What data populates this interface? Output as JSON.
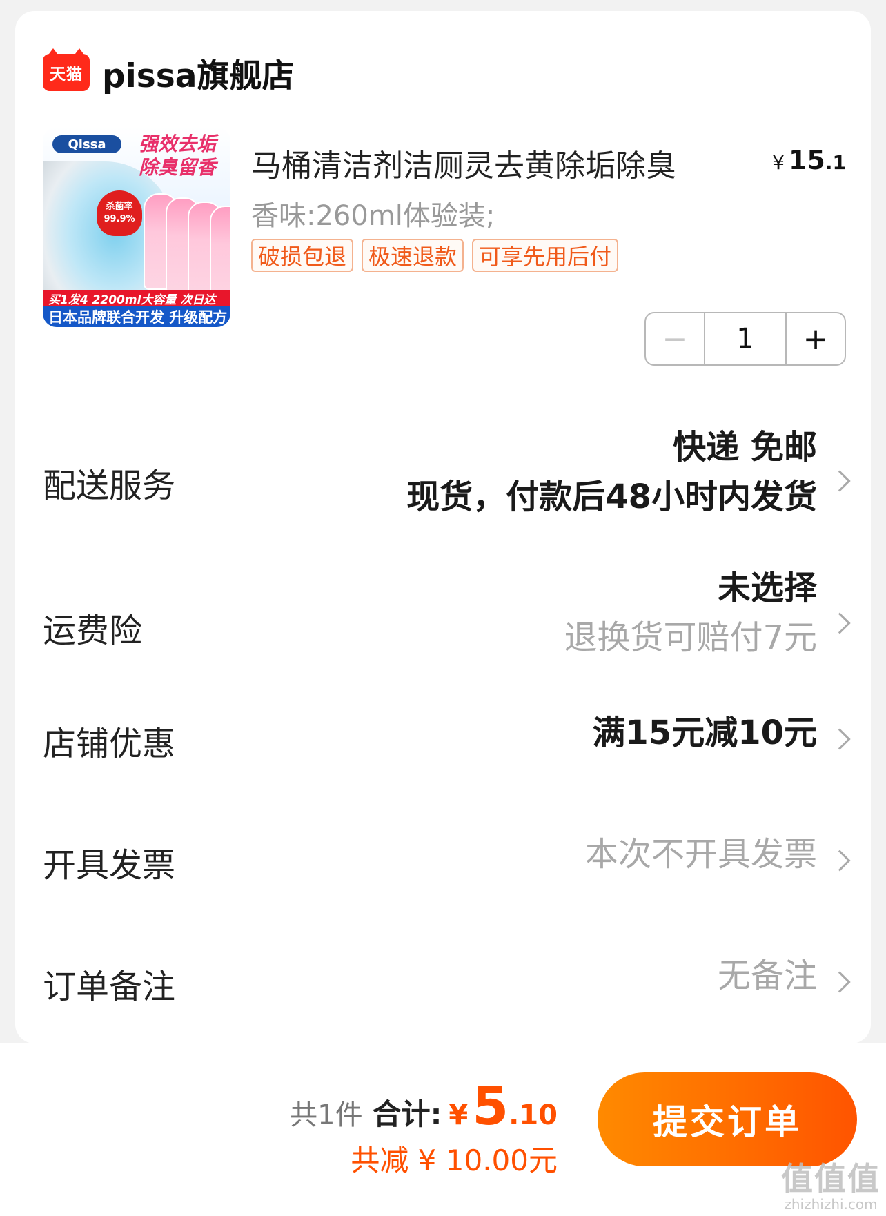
{
  "store": {
    "logo_text": "天猫",
    "name": "pissa旗舰店"
  },
  "product": {
    "title": "马桶清洁剂洁厕灵去黄除垢除臭",
    "price_symbol": "¥",
    "price_int": "15",
    "price_dec": ".1",
    "spec": "香味:260ml体验装;",
    "tags": [
      "破损包退",
      "极速退款",
      "可享先用后付"
    ],
    "quantity": "1",
    "thumb": {
      "brand": "Qissa",
      "slogan": "强效去垢 除臭留香",
      "badge_label": "杀菌率",
      "badge_value": "99.9%",
      "strip1": "买1发4 2200ml大容量 次日达",
      "strip2": "日本品牌联合开发 升级配方"
    }
  },
  "rows": {
    "delivery": {
      "label": "配送服务",
      "line1": "快递 免邮",
      "line2": "现货，付款后48小时内发货"
    },
    "shipping_insurance": {
      "label": "运费险",
      "line1": "未选择",
      "line2": "退换货可赔付7元"
    },
    "store_discount": {
      "label": "店铺优惠",
      "value": "满15元减10元"
    },
    "invoice": {
      "label": "开具发票",
      "value": "本次不开具发票"
    },
    "note": {
      "label": "订单备注",
      "value": "无备注"
    }
  },
  "footer": {
    "count_text": "共1件",
    "total_label": "合计:",
    "total_symbol": "¥",
    "total_int": "5",
    "total_dec": ".10",
    "discount_text": "共减 ¥ 10.00元",
    "submit_label": "提交订单"
  },
  "watermark": {
    "main": "值值值",
    "sub": "zhizhizhi.com"
  },
  "colors": {
    "accent": "#ff5000",
    "tag_border": "#f4b28f",
    "tmall_red": "#ff2a1a"
  }
}
